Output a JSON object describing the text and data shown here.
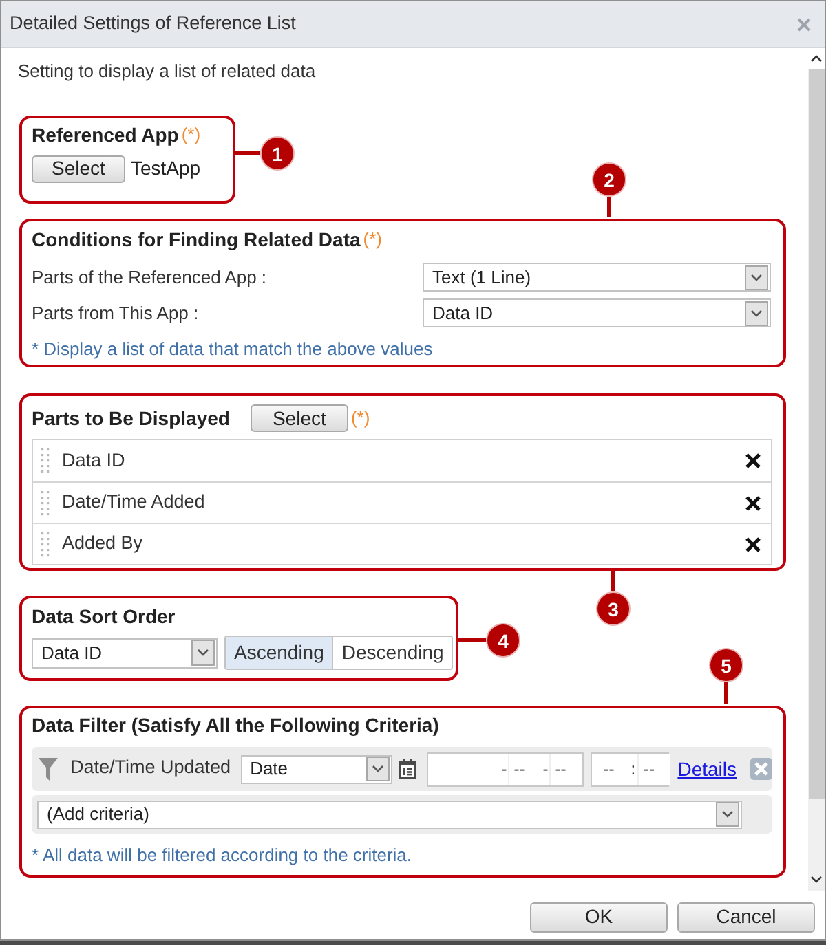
{
  "window": {
    "title": "Detailed Settings of Reference List"
  },
  "description": "Setting to display a list of related data",
  "referenced_app": {
    "callout": "1",
    "heading": "Referenced App",
    "required_mark": "(*)",
    "button": "Select",
    "value": "TestApp"
  },
  "conditions": {
    "callout": "2",
    "heading": "Conditions for Finding Related Data",
    "required_mark": "(*)",
    "fields": [
      {
        "label": "Parts of the Referenced App :",
        "value": "Text (1 Line)"
      },
      {
        "label": "Parts from This App :",
        "value": "Data ID"
      }
    ],
    "note": "* Display a list of data that match the above values"
  },
  "parts_displayed": {
    "callout": "3",
    "heading": "Parts to Be Displayed",
    "button": "Select",
    "required_mark": "(*)",
    "items": [
      "Data ID",
      "Date/Time Added",
      "Added By"
    ]
  },
  "sort_order": {
    "callout": "4",
    "heading": "Data Sort Order",
    "field": "Data ID",
    "options": [
      {
        "label": "Ascending",
        "selected": true
      },
      {
        "label": "Descending",
        "selected": false
      }
    ]
  },
  "filter": {
    "callout": "5",
    "heading": "Data Filter (Satisfy All the Following Criteria)",
    "criteria": [
      {
        "field": "Date/Time Updated",
        "operator": "Date",
        "date_separators": [
          "-",
          "-"
        ],
        "date_placeholders": [
          "--",
          "--"
        ],
        "time_separator": ":",
        "time_placeholders": [
          "--",
          "--"
        ],
        "link": "Details"
      }
    ],
    "add_criteria": "(Add criteria)",
    "note": "* All data will be filtered according to the criteria."
  },
  "buttons": [
    "OK",
    "Cancel"
  ]
}
